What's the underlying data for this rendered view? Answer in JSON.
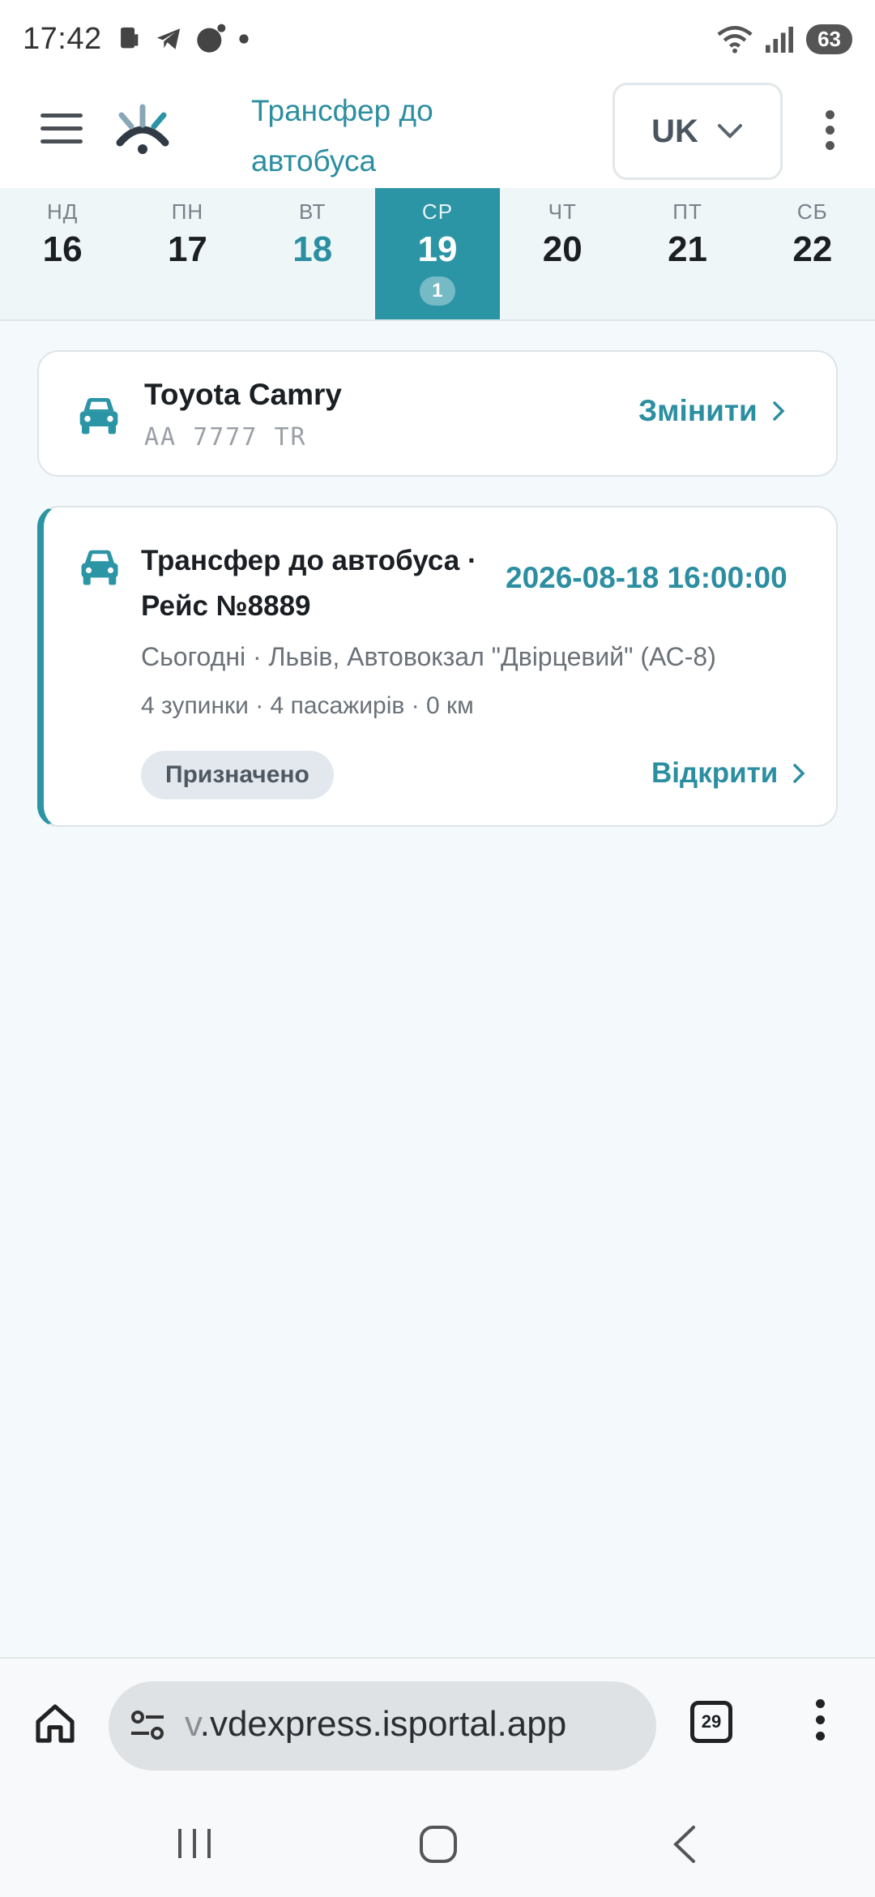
{
  "status_bar": {
    "time": "17:42",
    "battery": "63",
    "icons": [
      "phone-icon",
      "telegram-icon",
      "dot-icon",
      "wifi-icon",
      "signal-icon",
      "battery-icon"
    ]
  },
  "header": {
    "title": "Трансфер до автобуса",
    "language": "UK",
    "icons": [
      "menu-icon",
      "app-logo",
      "chevron-down-icon",
      "more-vert-icon"
    ]
  },
  "week": {
    "days": [
      {
        "dow": "НД",
        "num": "16"
      },
      {
        "dow": "ПН",
        "num": "17"
      },
      {
        "dow": "ВТ",
        "num": "18"
      },
      {
        "dow": "СР",
        "num": "19",
        "badge": "1"
      },
      {
        "dow": "ЧТ",
        "num": "20"
      },
      {
        "dow": "ПТ",
        "num": "21"
      },
      {
        "dow": "СБ",
        "num": "22"
      }
    ],
    "selected_index": 3,
    "today_index": 2
  },
  "vehicle": {
    "name": "Toyota Camry",
    "plate": "AA 7777 TR",
    "change_label": "Змінити"
  },
  "trip": {
    "title": "Трансфер до автобуса · Рейс №8889",
    "datetime": "2026-08-18 16:00:00",
    "route": "Сьогодні · Львів, Автовокзал \"Двірцевий\" (АС-8)",
    "stats": "4 зупинки · 4 пасажирів · 0 км",
    "status": "Призначено",
    "open_label": "Відкрити"
  },
  "browser": {
    "url_faded": "v",
    "url": ".vdexpress.isportal.app",
    "tab_count": "29"
  },
  "colors": {
    "accent": "#2b95a5",
    "accent_text": "#2b8ea1",
    "background": "#f4f9fb"
  }
}
